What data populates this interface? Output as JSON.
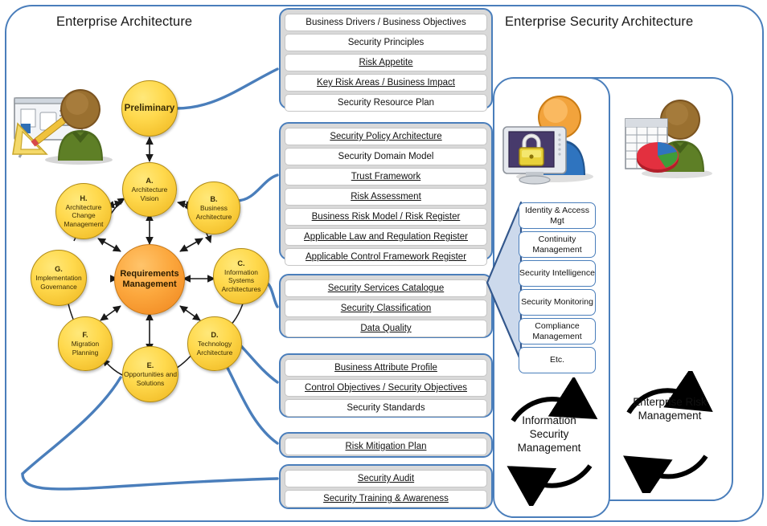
{
  "panels": {
    "left_title": "Enterprise Architecture",
    "right_title": "Enterprise Security Architecture"
  },
  "adm": {
    "preliminary": "Preliminary",
    "center": "Requirements Management",
    "phases": [
      {
        "letter": "A.",
        "name": "Architecture Vision"
      },
      {
        "letter": "B.",
        "name": "Business Architecture"
      },
      {
        "letter": "C.",
        "name": "Information Systems Architectures"
      },
      {
        "letter": "D.",
        "name": "Technology Architecture"
      },
      {
        "letter": "E.",
        "name": "Opportunities and Solutions"
      },
      {
        "letter": "F.",
        "name": "Migration Planning"
      },
      {
        "letter": "G.",
        "name": "Implementation Governance"
      },
      {
        "letter": "H.",
        "name": "Architecture Change Management"
      }
    ]
  },
  "groups": [
    {
      "id": "group-preliminary",
      "rows": [
        {
          "text": "Business Drivers / Business Objectives",
          "underline": false
        },
        {
          "text": "Security Principles",
          "underline": false
        },
        {
          "text": "Risk Appetite",
          "underline": true
        },
        {
          "text": "Key Risk Areas / Business Impact",
          "underline": true
        },
        {
          "text": "Security Resource Plan",
          "underline": false
        }
      ]
    },
    {
      "id": "group-architecture-vision",
      "rows": [
        {
          "text": "Security Policy Architecture",
          "underline": true
        },
        {
          "text": "Security Domain Model",
          "underline": false
        },
        {
          "text": "Trust Framework",
          "underline": true
        },
        {
          "text": "Risk Assessment",
          "underline": true
        },
        {
          "text": "Business Risk Model / Risk Register",
          "underline": true
        },
        {
          "text": "Applicable Law and Regulation Register",
          "underline": true
        },
        {
          "text": "Applicable Control Framework Register",
          "underline": true
        }
      ]
    },
    {
      "id": "group-security-services",
      "rows": [
        {
          "text": "Security Services Catalogue",
          "underline": true
        },
        {
          "text": "Security Classification",
          "underline": true
        },
        {
          "text": "Data Quality",
          "underline": true
        }
      ]
    },
    {
      "id": "group-business-attributes",
      "rows": [
        {
          "text": "Business Attribute Profile",
          "underline": true
        },
        {
          "text": "Control Objectives / Security Objectives",
          "underline": true
        },
        {
          "text": "Security Standards",
          "underline": false
        }
      ]
    },
    {
      "id": "group-risk-mitigation",
      "rows": [
        {
          "text": "Risk Mitigation Plan",
          "underline": true
        }
      ]
    },
    {
      "id": "group-audit",
      "rows": [
        {
          "text": "Security Audit",
          "underline": true
        },
        {
          "text": "Security Training & Awareness",
          "underline": true
        }
      ]
    }
  ],
  "services": [
    "Identity & Access Mgt",
    "Continuity Management",
    "Security Intelligence",
    "Security Monitoring",
    "Compliance Management",
    "Etc."
  ],
  "cycles": {
    "information_security_management": "Information Security Management",
    "enterprise_risk_management": "Enterprise Risk Management"
  },
  "icons": {
    "architect": "architect-person-icon",
    "security_officer": "security-person-computer-lock-icon",
    "risk_analyst": "risk-person-spreadsheet-piechart-icon"
  },
  "colors": {
    "frame_blue": "#4a7ebb",
    "group_fill": "#d9d9d9",
    "node_yellow": "#ffd94d",
    "node_orange": "#f4922a",
    "chevron_fill": "#ccd9ec"
  }
}
